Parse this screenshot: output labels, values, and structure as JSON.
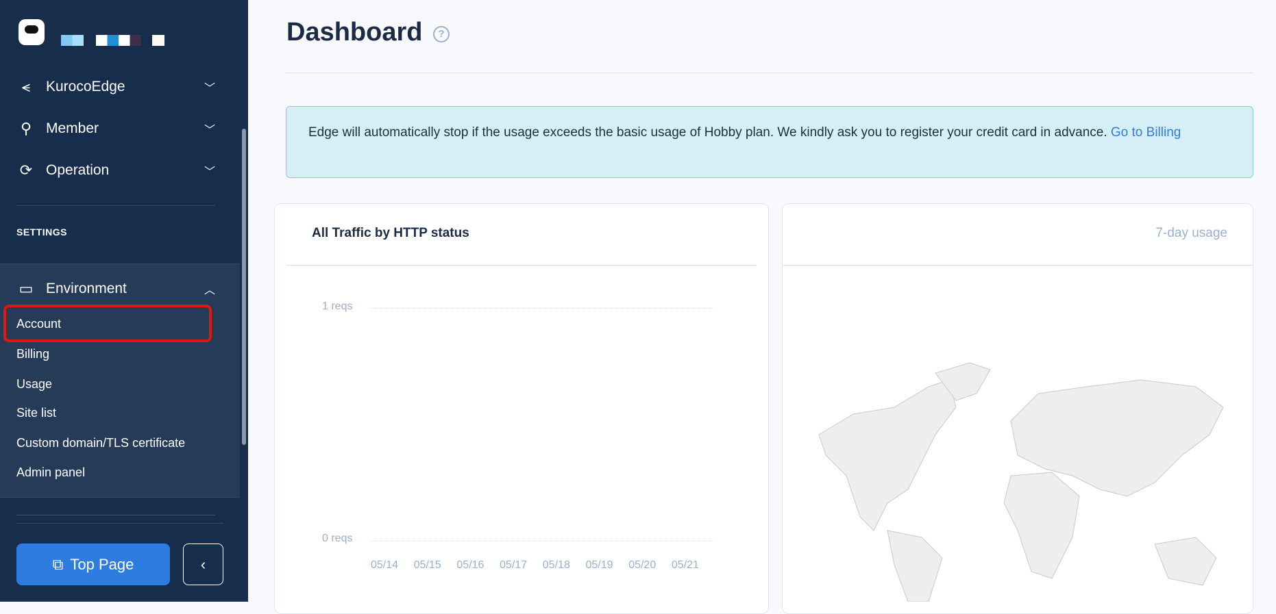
{
  "sidebar": {
    "nav": [
      {
        "label": "KurocoEdge",
        "icon": "share-icon"
      },
      {
        "label": "Member",
        "icon": "user-icon"
      },
      {
        "label": "Operation",
        "icon": "sync-icon"
      }
    ],
    "settings_heading": "SETTINGS",
    "environment": {
      "label": "Environment",
      "icon": "drive-icon",
      "items": [
        "Account",
        "Billing",
        "Usage",
        "Site list",
        "Custom domain/TLS certificate",
        "Admin panel"
      ]
    },
    "top_page": "Top Page",
    "highlight_color": "#e0180f"
  },
  "main": {
    "title": "Dashboard",
    "alert": {
      "text": "Edge will automatically stop if the usage exceeds the basic usage of Hobby plan. We kindly ask you to register your credit card in advance.",
      "link": "Go to Billing"
    },
    "map_card": {
      "title": "7-day usage"
    }
  },
  "chart_data": {
    "type": "line",
    "title": "All Traffic by HTTP status",
    "categories": [
      "05/14",
      "05/15",
      "05/16",
      "05/17",
      "05/18",
      "05/19",
      "05/20",
      "05/21"
    ],
    "y_ticks": [
      "1 reqs",
      "0 reqs"
    ],
    "ylim": [
      0,
      1
    ],
    "series": [],
    "grid": true
  }
}
